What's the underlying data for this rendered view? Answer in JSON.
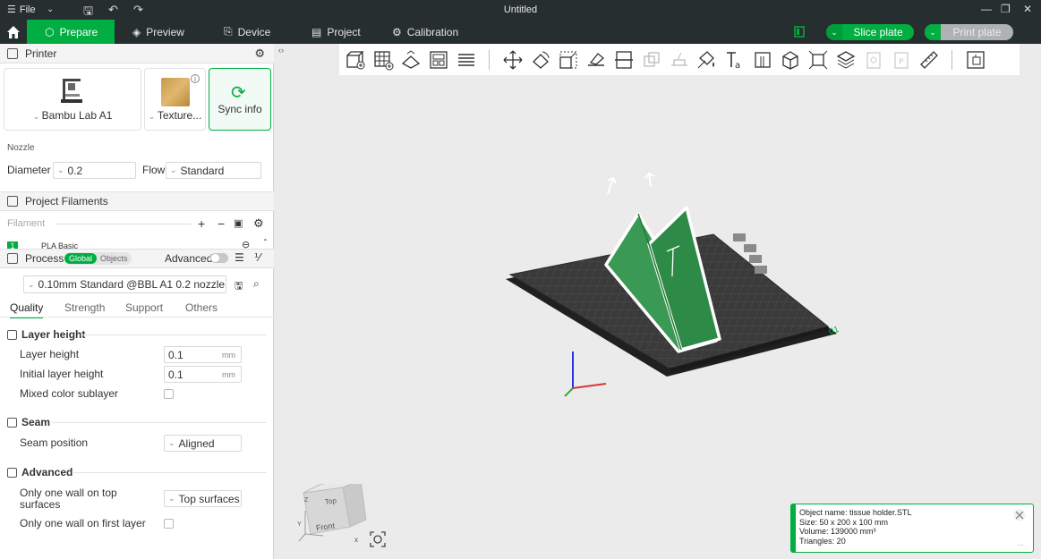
{
  "titlebar": {
    "file_label": "File",
    "title": "Untitled"
  },
  "nav": {
    "tabs": [
      {
        "label": "Prepare",
        "icon": "cube-icon"
      },
      {
        "label": "Preview",
        "icon": "layers-icon"
      },
      {
        "label": "Device",
        "icon": "device-icon"
      },
      {
        "label": "Project",
        "icon": "project-icon"
      },
      {
        "label": "Calibration",
        "icon": "gear-icon"
      }
    ],
    "slice_label": "Slice plate",
    "print_label": "Print plate"
  },
  "printer": {
    "header": "Printer",
    "printer_name": "Bambu Lab A1",
    "plate_name": "Texture...",
    "sync_label": "Sync info",
    "nozzle_label": "Nozzle",
    "diameter_label": "Diameter",
    "diameter_value": "0.2",
    "flow_label": "Flow",
    "flow_value": "Standard"
  },
  "filaments": {
    "header": "Project Filaments",
    "filament_label": "Filament",
    "first_index": "1",
    "first_name": "PLA Basic"
  },
  "process": {
    "header": "Process",
    "global_label": "Global",
    "objects_label": "Objects",
    "advanced_label": "Advanced",
    "preset": "0.10mm Standard @BBL A1 0.2 nozzle",
    "tabs": [
      "Quality",
      "Strength",
      "Support",
      "Others"
    ],
    "groups": {
      "layer_height": "Layer height",
      "seam": "Seam",
      "advanced": "Advanced"
    },
    "options": {
      "layer_height_label": "Layer height",
      "layer_height_value": "0.1",
      "initial_layer_label": "Initial layer height",
      "initial_layer_value": "0.1",
      "unit": "mm",
      "mixed_color_label": "Mixed color sublayer",
      "seam_position_label": "Seam position",
      "seam_position_value": "Aligned",
      "one_wall_top_label": "Only one wall on top surfaces",
      "one_wall_top_value": "Top surfaces",
      "one_wall_first_label": "Only one wall on first layer"
    }
  },
  "viewcube": {
    "top": "Top",
    "front": "Front",
    "z": "Z",
    "x": "x",
    "y": "Y"
  },
  "object_info": {
    "name": "Object name: tissue holder.STL",
    "size": "Size: 50 x 200 x 100 mm",
    "volume": "Volume: 139000 mm³",
    "triangles": "Triangles: 20"
  },
  "colors": {
    "accent": "#00ae42",
    "dark": "#262e30",
    "model": "#2e8b47"
  }
}
